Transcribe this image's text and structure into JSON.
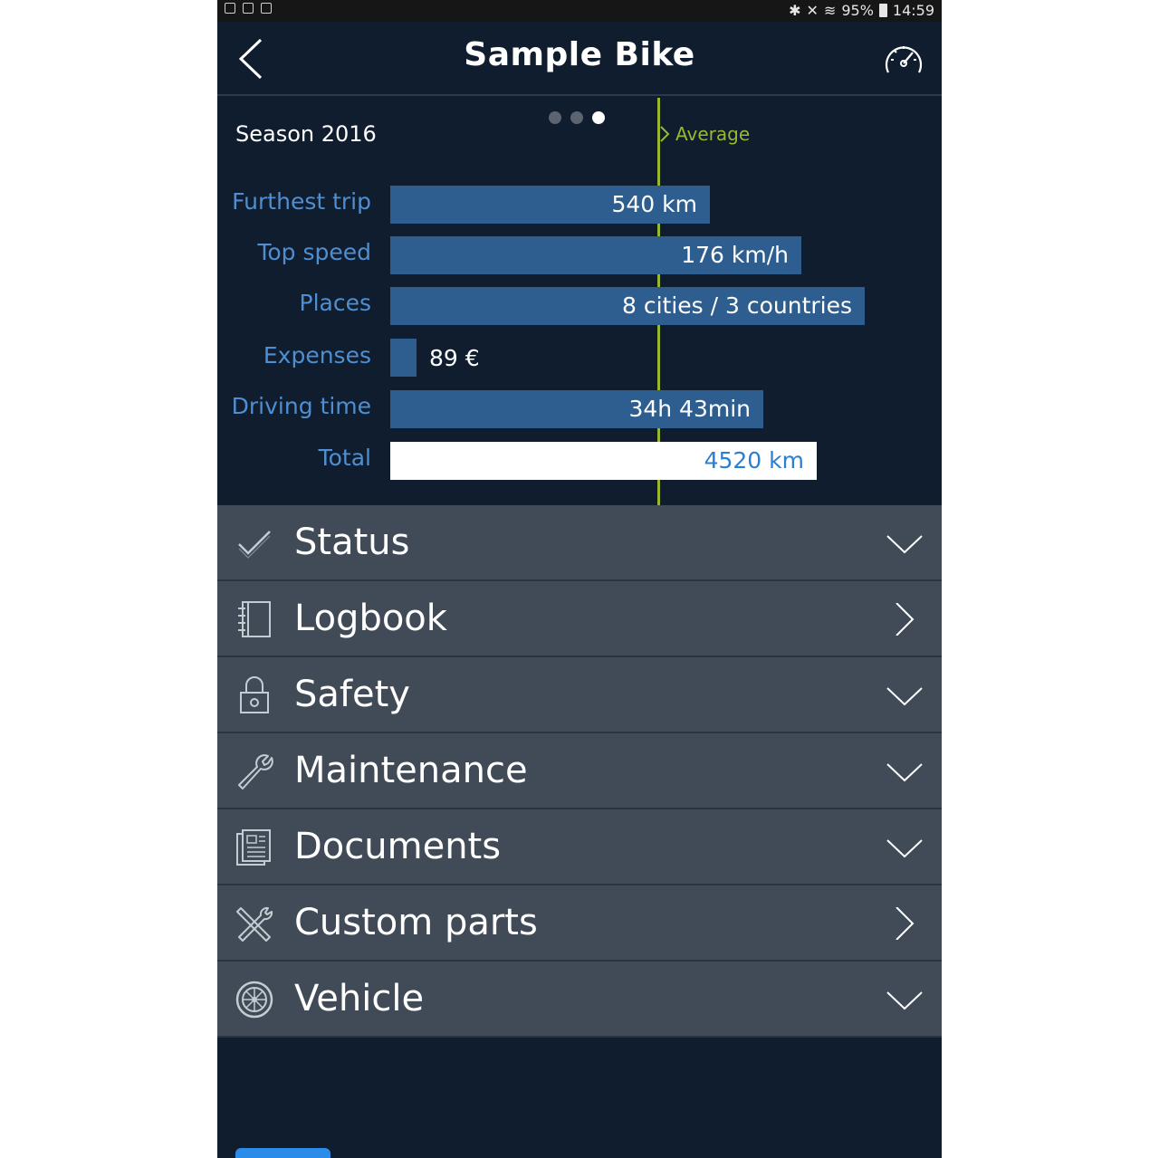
{
  "status_bar": {
    "battery": "95%",
    "time": "14:59"
  },
  "header": {
    "title": "Sample Bike"
  },
  "stats": {
    "season_label": "Season 2016",
    "average_label": "Average",
    "pager": {
      "count": 3,
      "active_index": 2
    },
    "rows": [
      {
        "label": "Furthest trip",
        "value": "540 km"
      },
      {
        "label": "Top speed",
        "value": "176 km/h"
      },
      {
        "label": "Places",
        "value": "8 cities / 3 countries"
      },
      {
        "label": "Expenses",
        "value": "89 €"
      },
      {
        "label": "Driving time",
        "value": "34h 43min"
      },
      {
        "label": "Total",
        "value": "4520 km"
      }
    ]
  },
  "menu": {
    "items": [
      {
        "label": "Status",
        "icon": "checkmark-icon",
        "indicator": "chevron-down-icon"
      },
      {
        "label": "Logbook",
        "icon": "notebook-icon",
        "indicator": "chevron-right-icon"
      },
      {
        "label": "Safety",
        "icon": "lock-icon",
        "indicator": "chevron-down-icon"
      },
      {
        "label": "Maintenance",
        "icon": "wrench-icon",
        "indicator": "chevron-down-icon"
      },
      {
        "label": "Documents",
        "icon": "document-icon",
        "indicator": "chevron-down-icon"
      },
      {
        "label": "Custom parts",
        "icon": "tools-icon",
        "indicator": "chevron-right-icon"
      },
      {
        "label": "Vehicle",
        "icon": "wheel-icon",
        "indicator": "chevron-down-icon"
      }
    ]
  },
  "colors": {
    "background": "#0f1d2e",
    "bar": "#2e5e8f",
    "label_blue": "#4f8fd1",
    "average_green": "#9ab82f",
    "menu_item": "#414b57"
  }
}
